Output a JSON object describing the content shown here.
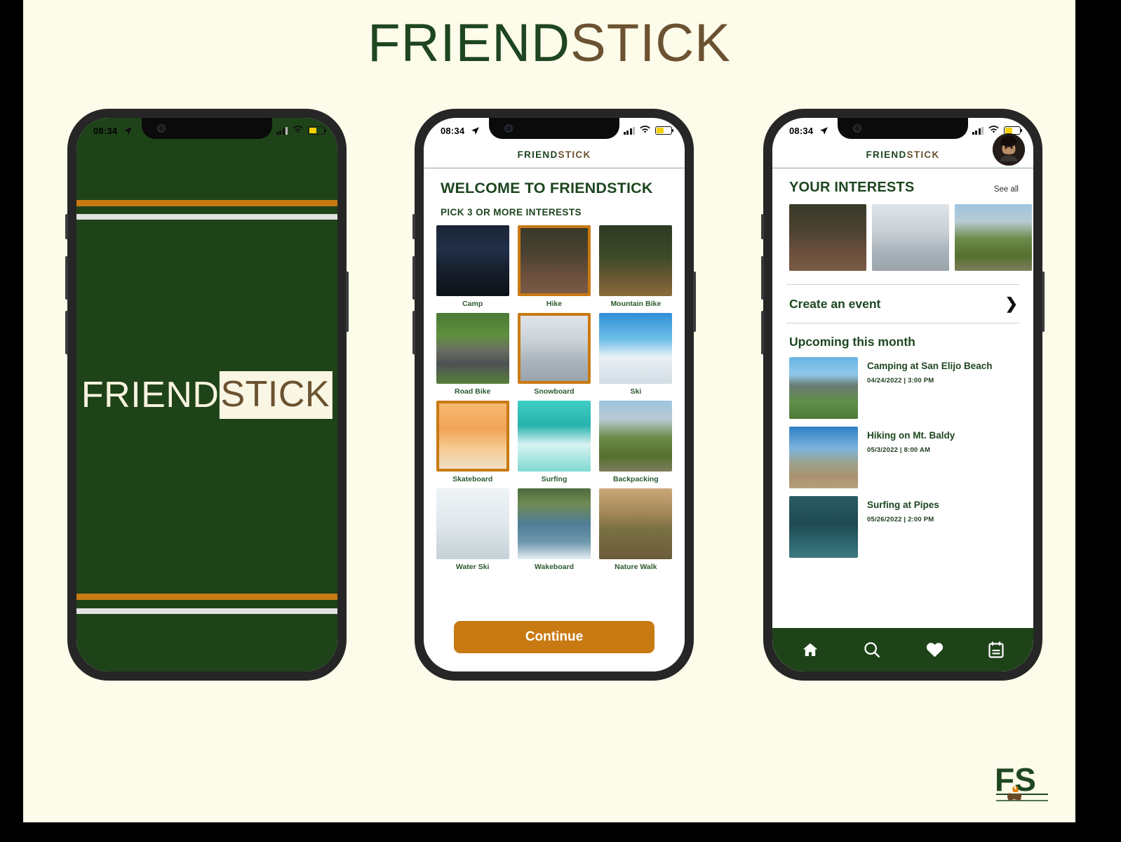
{
  "page": {
    "title_part1": "FRIEND",
    "title_part2": "STICK",
    "background_color": "#FDFBE9",
    "brand_green": "#1E4620",
    "brand_brown": "#6B5230",
    "brand_orange": "#C87A12"
  },
  "status_bar": {
    "time": "08:34",
    "location_icon": "location-arrow-icon",
    "signal_icon": "cellular-signal-icon",
    "wifi_icon": "wifi-icon",
    "battery_icon": "battery-icon",
    "battery_level": "52%"
  },
  "phone1": {
    "name": "splash-screen",
    "background_color": "#1F4319",
    "logo_part1": "FRIEND",
    "logo_part2": "STICK",
    "stripe_orange": "#C87A12",
    "stripe_white": "#E2E2E2"
  },
  "phone2": {
    "name": "interest-picker-screen",
    "header_logo_part1": "FRIEND",
    "header_logo_part2": "STICK",
    "welcome_heading": "WELCOME TO FRIENDSTICK",
    "subheading": "PICK 3 OR MORE INTERESTS",
    "continue_label": "Continue",
    "interests": [
      {
        "label": "Camp",
        "selected": false,
        "image": "tent-at-night-photo"
      },
      {
        "label": "Hike",
        "selected": true,
        "image": "hikers-in-autumn-forest-photo"
      },
      {
        "label": "Mountain Bike",
        "selected": false,
        "image": "mountain-biker-jumping-photo"
      },
      {
        "label": "Road Bike",
        "selected": false,
        "image": "road-cyclist-on-mountain-road-photo"
      },
      {
        "label": "Snowboard",
        "selected": true,
        "image": "snowboarder-carving-powder-photo"
      },
      {
        "label": "Ski",
        "selected": false,
        "image": "skier-carving-turn-photo"
      },
      {
        "label": "Skateboard",
        "selected": true,
        "image": "skateboarder-sunset-jump-photo"
      },
      {
        "label": "Surfing",
        "selected": false,
        "image": "surfer-in-barrel-wave-photo"
      },
      {
        "label": "Backpacking",
        "selected": false,
        "image": "backpackers-on-mountain-trail-photo"
      },
      {
        "label": "Water Ski",
        "selected": false,
        "image": "water-skier-spray-photo"
      },
      {
        "label": "Wakeboard",
        "selected": false,
        "image": "wakeboarder-on-lake-photo"
      },
      {
        "label": "Nature Walk",
        "selected": false,
        "image": "mother-and-child-forest-walk-photo"
      }
    ]
  },
  "phone3": {
    "name": "home-screen",
    "header_logo_part1": "FRIEND",
    "header_logo_part2": "STICK",
    "avatar": "user-profile-photo",
    "interests_title": "YOUR INTERESTS",
    "see_all_label": "See all",
    "interest_thumbs": [
      "hikers-in-autumn-forest-photo",
      "snowboarder-carving-powder-photo",
      "backpackers-on-mountain-trail-photo"
    ],
    "create_event_label": "Create an event",
    "upcoming_title": "Upcoming this month",
    "events": [
      {
        "title": "Camping at San Elijo Beach",
        "date": "04/24/2022 | 3:00 PM",
        "image": "beach-cliff-campsite-photo"
      },
      {
        "title": "Hiking on Mt. Baldy",
        "date": "05/3/2022 | 8:00 AM",
        "image": "mountain-ridge-trail-photo"
      },
      {
        "title": "Surfing at Pipes",
        "date": "05/26/2022 | 2:00 PM",
        "image": "aerial-ocean-surf-photo"
      }
    ],
    "tabs": [
      {
        "name": "home-tab",
        "icon": "home-icon"
      },
      {
        "name": "search-tab",
        "icon": "search-icon"
      },
      {
        "name": "favorites-tab",
        "icon": "heart-icon"
      },
      {
        "name": "calendar-tab",
        "icon": "calendar-icon"
      }
    ],
    "tabbar_color": "#1F4319"
  },
  "footer": {
    "logo_text": "FS",
    "logo_icon": "campfire-icon"
  }
}
